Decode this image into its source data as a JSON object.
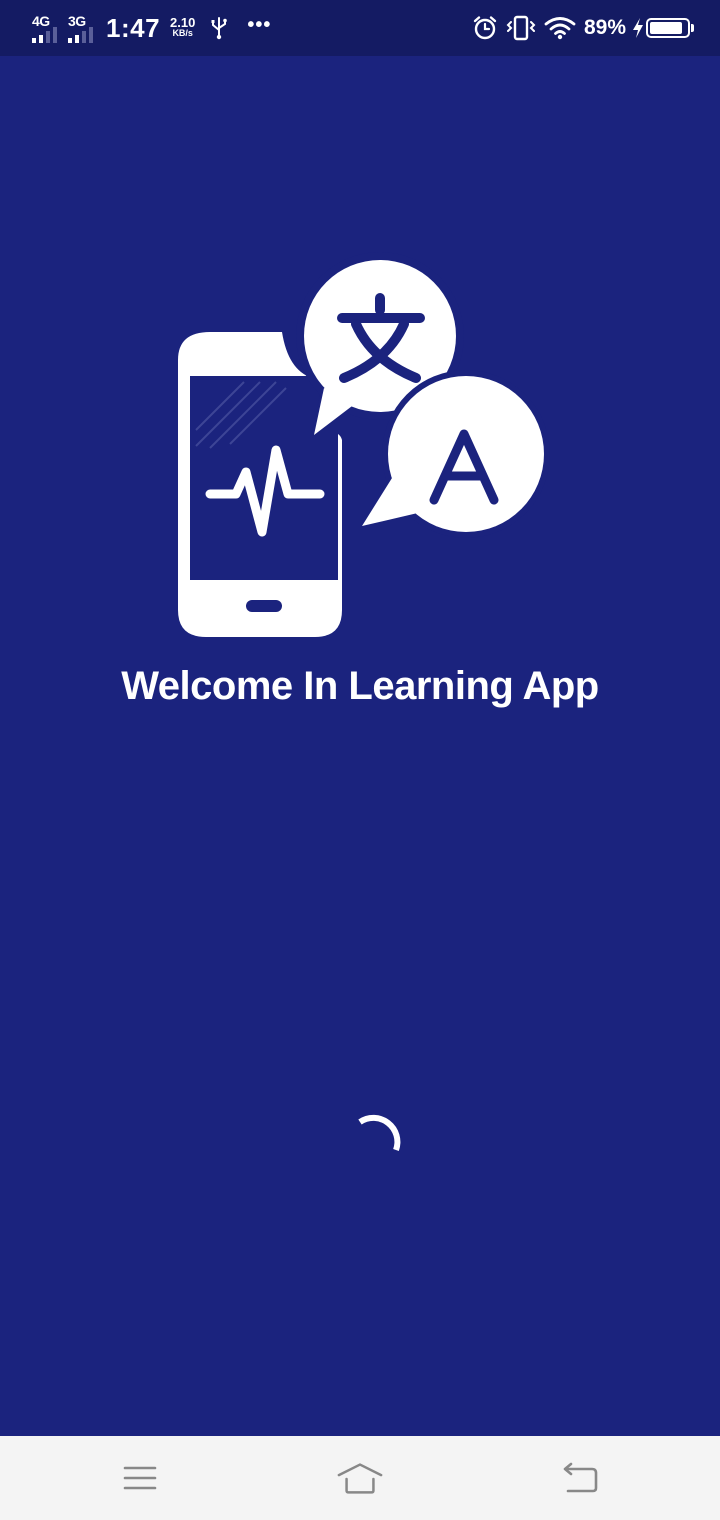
{
  "status_bar": {
    "network1": "4G",
    "network2": "3G",
    "time": "1:47",
    "speed_value": "2.10",
    "speed_unit": "KB/s",
    "overflow": "•••",
    "battery_percent": "89%",
    "battery_level": 0.89,
    "icons": [
      "usb-icon",
      "alarm-icon",
      "vibrate-icon",
      "wifi-icon",
      "charging-bolt-icon",
      "battery-icon"
    ]
  },
  "splash": {
    "logo": "phone-translate-logo",
    "logo_glyphs": [
      "文",
      "A"
    ],
    "title": "Welcome In Learning App",
    "loading": "spinner-icon"
  },
  "nav_bar": {
    "buttons": [
      "menu-icon",
      "home-icon",
      "back-icon"
    ]
  },
  "colors": {
    "background": "#1b237e",
    "status_bar": "#141b63",
    "foreground": "#ffffff",
    "nav_bar": "#f4f4f4",
    "nav_icon": "#888888"
  }
}
